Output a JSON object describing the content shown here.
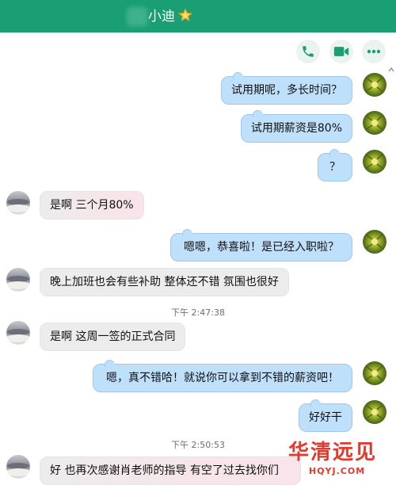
{
  "header": {
    "contact_name": "小迪",
    "accent_color": "#1a9e74",
    "star_icon": "star-icon"
  },
  "toolbar": {
    "icons": [
      "phone-icon",
      "video-call-icon",
      "more-icon"
    ]
  },
  "messages": [
    {
      "sender": "me",
      "text": "试用期呢，多长时间？"
    },
    {
      "sender": "me",
      "text": "试用期薪资是80%"
    },
    {
      "sender": "me",
      "text": "？"
    },
    {
      "sender": "other",
      "text": "是啊  三个月80%"
    },
    {
      "sender": "me",
      "text": "嗯嗯，恭喜啦！是已经入职啦？"
    },
    {
      "sender": "other",
      "text": "晚上加班也会有些补助   整体还不错   氛围也很好"
    },
    {
      "sender": "other",
      "text": "是啊    这周一签的正式合同"
    },
    {
      "sender": "me",
      "text": "嗯，真不错哈！就说你可以拿到不错的薪资吧！"
    },
    {
      "sender": "me",
      "text": "好好干"
    },
    {
      "sender": "other",
      "text": "好   也再次感谢肖老师的指导    有空了过去找你们"
    }
  ],
  "timestamps": [
    "下午 2:47:38",
    "下午 2:50:53"
  ],
  "watermark": {
    "main": "华清远见",
    "sub": "HQYJ.COM"
  }
}
